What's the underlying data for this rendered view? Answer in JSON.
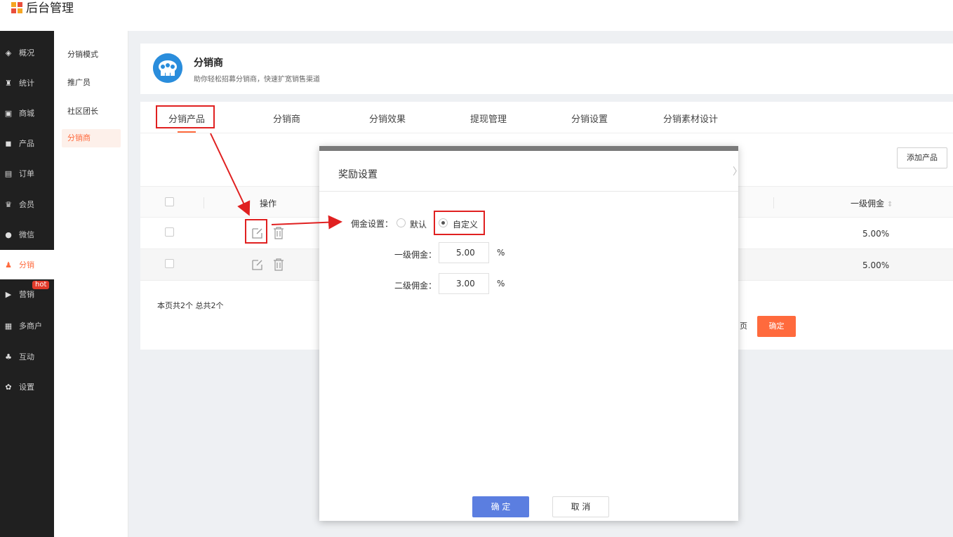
{
  "app": {
    "title": "后台管理"
  },
  "sidebar": {
    "items": [
      {
        "label": "概况",
        "icon": "layers-icon"
      },
      {
        "label": "统计",
        "icon": "chart-icon"
      },
      {
        "label": "商城",
        "icon": "shop-icon"
      },
      {
        "label": "产品",
        "icon": "grid-icon"
      },
      {
        "label": "订单",
        "icon": "order-icon"
      },
      {
        "label": "会员",
        "icon": "crown-icon"
      },
      {
        "label": "微信",
        "icon": "wechat-icon"
      },
      {
        "label": "分销",
        "icon": "users-icon"
      },
      {
        "label": "营销",
        "icon": "flag-icon"
      },
      {
        "label": "多商户",
        "icon": "store-icon"
      },
      {
        "label": "互动",
        "icon": "interact-icon"
      },
      {
        "label": "设置",
        "icon": "gear-icon"
      }
    ],
    "active": "分销",
    "hot_badge": "hot"
  },
  "subnav": {
    "items": [
      "分销模式",
      "推广员",
      "社区团长",
      "分销商"
    ],
    "active": "分销商"
  },
  "header": {
    "title": "分销商",
    "subtitle": "助你轻松招募分销商，快速扩宽销售渠道"
  },
  "tabs": [
    "分销产品",
    "分销商",
    "分销效果",
    "提现管理",
    "分销设置",
    "分销素材设计"
  ],
  "toolbar": {
    "add_product": "添加产品"
  },
  "table": {
    "col_op": "操作",
    "col_level1": "一级佣金",
    "rows": [
      {
        "level1": "5.00%"
      },
      {
        "level1": "5.00%"
      }
    ]
  },
  "footer": {
    "summary": "本页共2个  总共2个",
    "page_tail": "页",
    "confirm": "确定"
  },
  "dialog": {
    "title": "奖励设置",
    "commission_label": "佣金设置：",
    "option_default": "默认",
    "option_custom": "自定义",
    "selected_option": "自定义",
    "level1_label": "一级佣金：",
    "level1_value": "5.00",
    "level2_label": "二级佣金：",
    "level2_value": "3.00",
    "percent": "%",
    "ok": "确 定",
    "cancel": "取 消"
  },
  "colors": {
    "accent": "#ff6a3d",
    "sidebar_bg": "#202020",
    "primary_button": "#5b7ee0",
    "annotation": "#e02020",
    "hot_badge": "#e23b2b"
  }
}
